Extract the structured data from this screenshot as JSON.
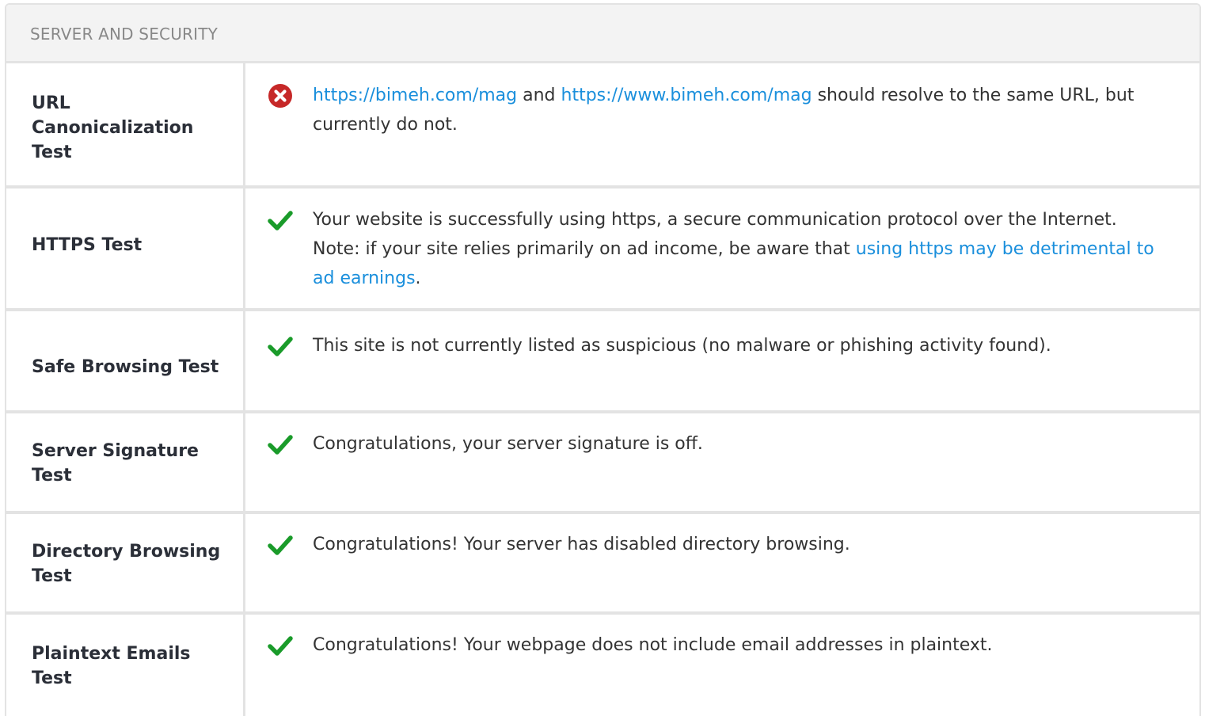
{
  "section": {
    "title": "SERVER AND SECURITY"
  },
  "colors": {
    "pass": "#1a9b2a",
    "fail": "#c62828",
    "link": "#1a8fdc"
  },
  "rows": [
    {
      "label": "URL Canonicalization Test",
      "status_icon": "fail-x-icon",
      "parts": [
        {
          "text": "https://bimeh.com/mag",
          "link": true
        },
        {
          "text": " and ",
          "link": false
        },
        {
          "text": "https://www.bimeh.com/mag",
          "link": true
        },
        {
          "text": " should resolve to the same URL, but currently do not.",
          "link": false
        }
      ]
    },
    {
      "label": "HTTPS Test",
      "status_icon": "pass-check-icon",
      "parts": [
        {
          "text": "Your website is successfully using https, a secure communication protocol over the Internet. Note: if your site relies primarily on ad income, be aware that ",
          "link": false
        },
        {
          "text": "using https may be detrimental to ad earnings",
          "link": true
        },
        {
          "text": ".",
          "link": false
        }
      ]
    },
    {
      "label": "Safe Browsing Test",
      "status_icon": "pass-check-icon",
      "parts": [
        {
          "text": "This site is not currently listed as suspicious (no malware or phishing activity found).",
          "link": false
        }
      ]
    },
    {
      "label": "Server Signature Test",
      "status_icon": "pass-check-icon",
      "parts": [
        {
          "text": "Congratulations, your server signature is off.",
          "link": false
        }
      ]
    },
    {
      "label": "Directory Browsing Test",
      "status_icon": "pass-check-icon",
      "parts": [
        {
          "text": "Congratulations! Your server has disabled directory browsing.",
          "link": false
        }
      ]
    },
    {
      "label": "Plaintext Emails Test",
      "status_icon": "pass-check-icon",
      "parts": [
        {
          "text": "Congratulations! Your webpage does not include email addresses in plaintext.",
          "link": false
        }
      ]
    }
  ]
}
